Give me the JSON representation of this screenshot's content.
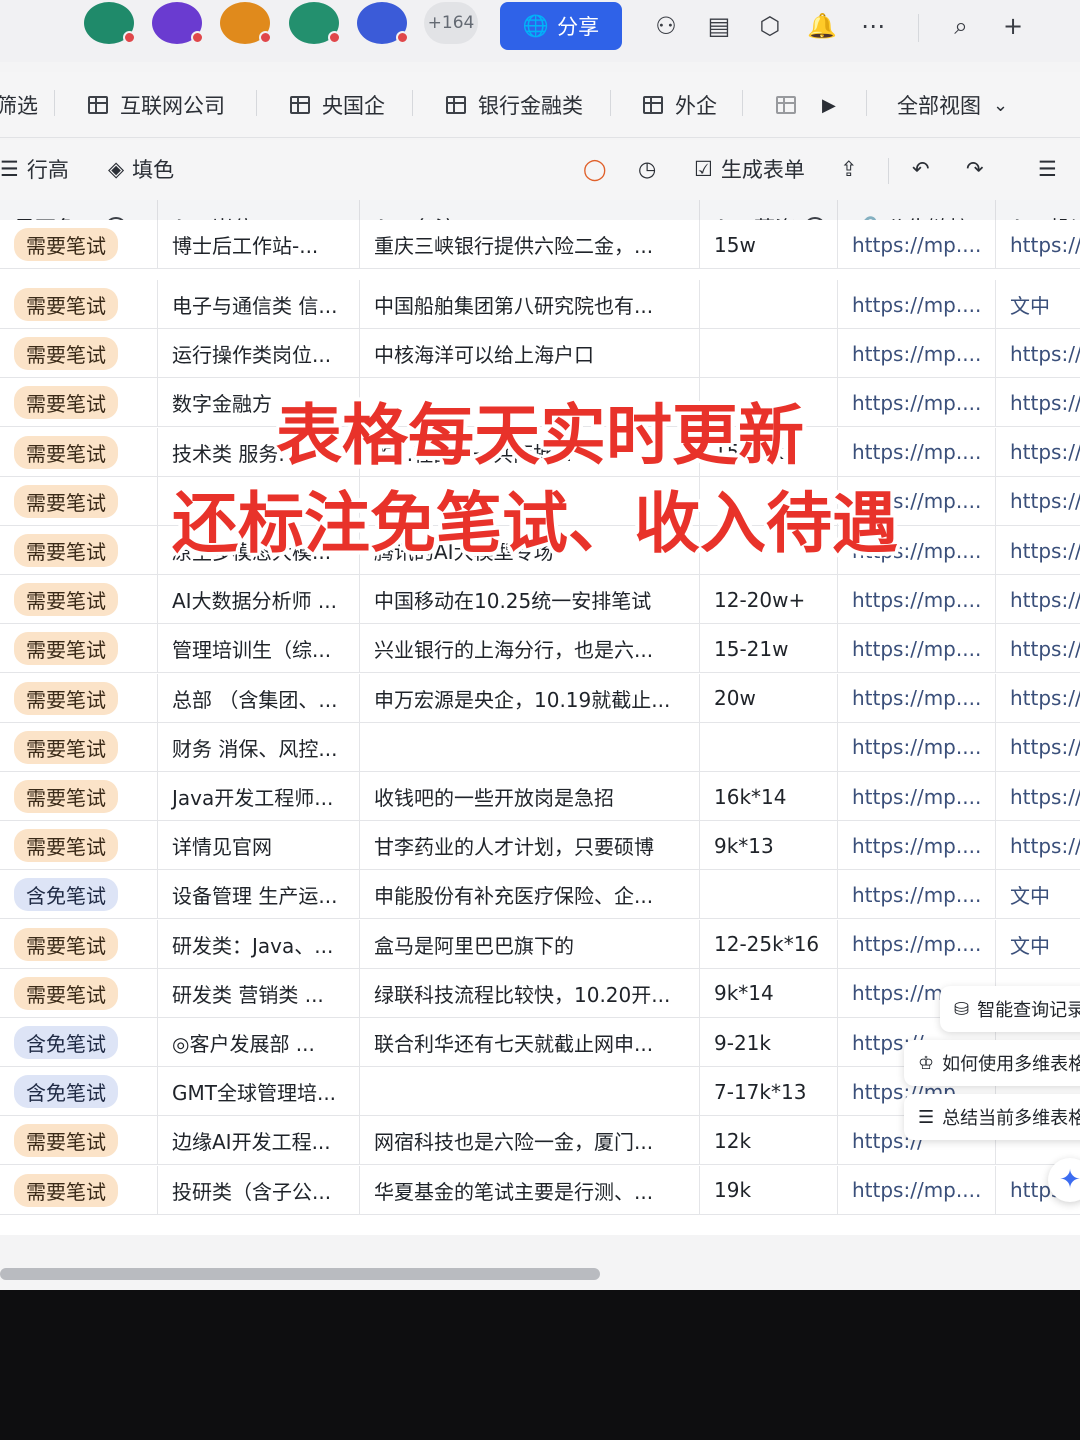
{
  "topbar": {
    "avatars": [
      {
        "color": "#1f8a6a"
      },
      {
        "color": "#6a3bd0"
      },
      {
        "color": "#e08a1c"
      },
      {
        "color": "#23906e"
      },
      {
        "color": "#3b5bd8"
      }
    ],
    "more_count": "+164",
    "share_label": "分享",
    "icons": [
      "robot-icon",
      "form-icon",
      "plugin-icon",
      "bell-icon",
      "more-icon",
      "search-icon",
      "plus-icon"
    ]
  },
  "tabs": {
    "partial_label": "筛选",
    "items": [
      {
        "label": "互联网公司"
      },
      {
        "label": "央国企"
      },
      {
        "label": "银行金融类"
      },
      {
        "label": "外企"
      }
    ],
    "all_views_label": "全部视图"
  },
  "toolbar": {
    "row_height_label": "行高",
    "fill_color_label": "填色",
    "generate_form_label": "生成表单"
  },
  "table": {
    "headers": {
      "exempt": "是否免...",
      "position": "岗位",
      "remark": "备注",
      "salary": "薪资",
      "link": "公告链接",
      "deliver": "投递"
    },
    "top_partial_row": {
      "status": "需要笔试",
      "position": "博士后工作站-...",
      "remark": "重庆三峡银行提供六险二金，...",
      "salary": "15w",
      "link": "https://mp....",
      "deliver": "https://"
    },
    "rows": [
      {
        "status": "需要笔试",
        "type": "need",
        "position": "电子与通信类 信...",
        "remark": "中国船舶集团第八研究院也有...",
        "salary": "",
        "link": "https://mp....",
        "deliver": "文中"
      },
      {
        "status": "需要笔试",
        "type": "need",
        "position": "运行操作类岗位...",
        "remark": "中核海洋可以给上海户口",
        "salary": "",
        "link": "https://mp....",
        "deliver": "https://"
      },
      {
        "status": "需要笔试",
        "type": "need",
        "position": "数字金融方",
        "remark": "",
        "salary": "",
        "link": "https://mp....",
        "deliver": "https://"
      },
      {
        "status": "需要笔试",
        "type": "need",
        "position": "技术类 服务...",
        "remark": "的...程部，一共两批...",
        "salary": "15-25k",
        "link": "https://mp....",
        "deliver": "https://"
      },
      {
        "status": "需要笔试",
        "type": "need",
        "position": "",
        "remark": "",
        "salary": "",
        "link": "https://mp....",
        "deliver": "https://"
      },
      {
        "status": "需要笔试",
        "type": "need",
        "position": "原生多模态大模...",
        "remark": "腾讯的AI大模型专场",
        "salary": "",
        "link": "https://mp....",
        "deliver": "https://"
      },
      {
        "status": "需要笔试",
        "type": "need",
        "position": "AI大数据分析师 ...",
        "remark": "中国移动在10.25统一安排笔试",
        "salary": "12-20w+",
        "link": "https://mp....",
        "deliver": "https://"
      },
      {
        "status": "需要笔试",
        "type": "need",
        "position": "管理培训生（综...",
        "remark": "兴业银行的上海分行，也是六...",
        "salary": "15-21w",
        "link": "https://mp....",
        "deliver": "https://"
      },
      {
        "status": "需要笔试",
        "type": "need",
        "position": "总部 （含集团、...",
        "remark": "申万宏源是央企，10.19就截止...",
        "salary": "20w",
        "link": "https://mp....",
        "deliver": "https://"
      },
      {
        "status": "需要笔试",
        "type": "need",
        "position": "财务 消保、风控...",
        "remark": "",
        "salary": "",
        "link": "https://mp....",
        "deliver": "https://"
      },
      {
        "status": "需要笔试",
        "type": "need",
        "position": "Java开发工程师...",
        "remark": "收钱吧的一些开放岗是急招",
        "salary": "16k*14",
        "link": "https://mp....",
        "deliver": "https://"
      },
      {
        "status": "需要笔试",
        "type": "need",
        "position": "详情见官网",
        "remark": "甘李药业的人才计划，只要硕博",
        "salary": "9k*13",
        "link": "https://mp....",
        "deliver": "https://"
      },
      {
        "status": "含免笔试",
        "type": "free",
        "position": "设备管理 生产运...",
        "remark": "申能股份有补充医疗保险、企...",
        "salary": "",
        "link": "https://mp....",
        "deliver": "文中"
      },
      {
        "status": "需要笔试",
        "type": "need",
        "position": "研发类：Java、...",
        "remark": "盒马是阿里巴巴旗下的",
        "salary": "12-25k*16",
        "link": "https://mp....",
        "deliver": "文中"
      },
      {
        "status": "需要笔试",
        "type": "need",
        "position": "研发类 营销类 ...",
        "remark": "绿联科技流程比较快，10.20开...",
        "salary": "9k*14",
        "link": "https://mp",
        "deliver": ""
      },
      {
        "status": "含免笔试",
        "type": "free",
        "position": "◎客户发展部 ...",
        "remark": "联合利华还有七天就截止网申...",
        "salary": "9-21k",
        "link": "https://",
        "deliver": ""
      },
      {
        "status": "含免笔试",
        "type": "free",
        "position": "GMT全球管理培...",
        "remark": "",
        "salary": "7-17k*13",
        "link": "https://mp",
        "deliver": ""
      },
      {
        "status": "需要笔试",
        "type": "need",
        "position": "边缘AI开发工程...",
        "remark": "网宿科技也是六险一金，厦门...",
        "salary": "12k",
        "link": "https://",
        "deliver": ""
      },
      {
        "status": "需要笔试",
        "type": "need",
        "position": "投研类（含子公...",
        "remark": "华夏基金的笔试主要是行测、...",
        "salary": "19k",
        "link": "https://mp....",
        "deliver": "https"
      }
    ]
  },
  "overlay": {
    "line1": "表格每天实时更新",
    "line2": "还标注免笔试、收入待遇"
  },
  "side_menu": {
    "items": [
      {
        "label": "智能查询记录"
      },
      {
        "label": "如何使用多维表格"
      },
      {
        "label": "总结当前多维表格"
      }
    ]
  },
  "colors": {
    "accent": "#2f62e8",
    "need_pill": "#fbe3c8",
    "free_pill": "#dde4f6",
    "caption": "#e8322a"
  }
}
